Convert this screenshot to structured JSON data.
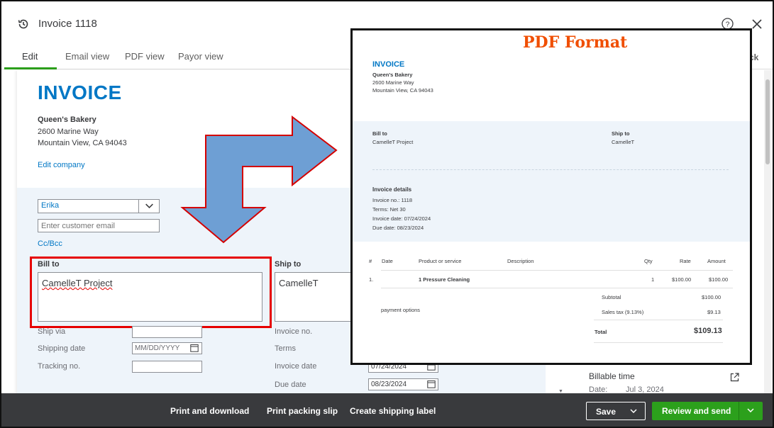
{
  "header": {
    "title": "Invoice 1118"
  },
  "tabs": [
    {
      "label": "Edit"
    },
    {
      "label": "Email view"
    },
    {
      "label": "PDF view"
    },
    {
      "label": "Payor view"
    }
  ],
  "tab_partial": "ck",
  "form": {
    "invoice_heading": "INVOICE",
    "company_name": "Queen's Bakery",
    "company_addr1": "2600 Marine Way",
    "company_addr2": "Mountain View, CA 94043",
    "edit_company": "Edit company",
    "customer": "Erika",
    "email_placeholder": "Enter customer email",
    "cc_bcc": "Cc/Bcc",
    "bill_to_label": "Bill to",
    "bill_to_value": "CamelleT Project",
    "ship_to_label": "Ship to",
    "ship_to_value": "CamelleT",
    "ship_via_label": "Ship via",
    "shipping_date_label": "Shipping date",
    "shipping_date_placeholder": "MM/DD/YYYY",
    "tracking_label": "Tracking no.",
    "invoice_no_label": "Invoice no.",
    "terms_label": "Terms",
    "invoice_date_label": "Invoice date",
    "invoice_date_value": "07/24/2024",
    "due_date_label": "Due date",
    "due_date_value": "08/23/2024"
  },
  "right_panel": {
    "billable_title": "Billable time",
    "date_label": "Date:",
    "date_value": "Jul 3, 2024"
  },
  "footer": {
    "print_download": "Print and download",
    "print_slip": "Print packing slip",
    "shipping_label": "Create shipping label",
    "save": "Save",
    "review_send": "Review and send"
  },
  "pdf": {
    "annotation": "PDF Format",
    "title": "INVOICE",
    "company_name": "Queen's Bakery",
    "company_addr1": "2600 Marine Way",
    "company_addr2": "Mountain View, CA 94043",
    "bill_to_label": "Bill to",
    "bill_to_value": "CamelleT Project",
    "ship_to_label": "Ship to",
    "ship_to_value": "CamelleT",
    "details_label": "Invoice details",
    "invoice_no": "Invoice no.: 1118",
    "terms": "Terms: Net 30",
    "invoice_date": "Invoice date: 07/24/2024",
    "due_date": "Due date: 08/23/2024",
    "columns": [
      "#",
      "Date",
      "Product or service",
      "Description",
      "Qty",
      "Rate",
      "Amount"
    ],
    "line": {
      "num": "1.",
      "product": "1 Pressure Cleaning",
      "qty": "1",
      "rate": "$100.00",
      "amount": "$100.00"
    },
    "payment_options": "payment options",
    "subtotal_label": "Subtotal",
    "subtotal_value": "$100.00",
    "tax_label": "Sales tax (9.13%)",
    "tax_value": "$9.13",
    "total_label": "Total",
    "total_value": "$109.13"
  },
  "colors": {
    "brand_blue": "#0077c5",
    "brand_green": "#2ca01c",
    "highlight_red": "#e60000",
    "arrow_blue": "#6e9fd4",
    "annotation_orange": "#f04e00",
    "footer_dark": "#393a3d"
  }
}
